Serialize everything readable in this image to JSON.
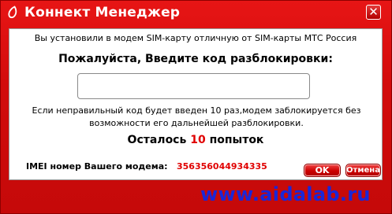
{
  "window": {
    "title": "Коннект Менеджер",
    "close_glyph": "✕"
  },
  "dialog": {
    "info": "Вы установили в модем SIM-карту отличную от SIM-карты МТС Россия",
    "prompt": "Пожалуйста, Введите код разблокировки:",
    "code_value": "",
    "warning": "Если неправильный код будет введен 10 раз,модем заблокируется без возможности его дальнейшей разблокировки.",
    "attempts_prefix": "Осталось",
    "attempts_count": "10",
    "attempts_suffix": "попыток",
    "imei_label": "IMEI номер Вашего модема:",
    "imei_value": "356356044934335",
    "ok_label": "OK",
    "cancel_label": "Отмена"
  },
  "watermark": "www.aidalab.ru",
  "colors": {
    "accent_red": "#d20c0c",
    "link_blue": "#1a27d8"
  },
  "icons": {
    "logo": "mts-logo-icon",
    "close": "close-icon"
  }
}
